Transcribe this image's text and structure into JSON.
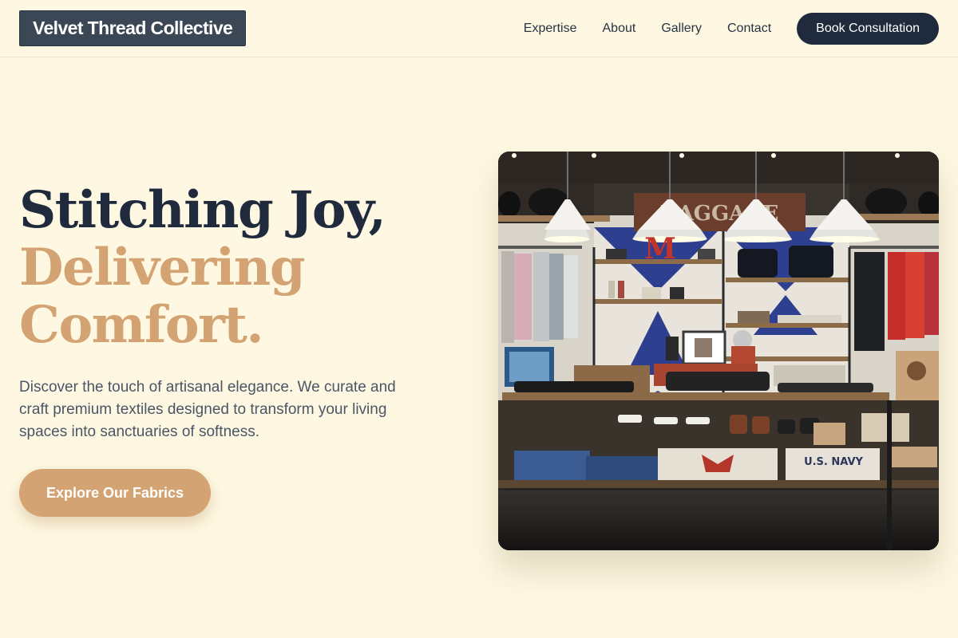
{
  "header": {
    "logo": "Velvet Thread Collective",
    "nav": [
      "Expertise",
      "About",
      "Gallery",
      "Contact"
    ],
    "cta": "Book Consultation"
  },
  "hero": {
    "title_line1": "Stitching Joy,",
    "title_line2": "Delivering",
    "title_line3": "Comfort.",
    "description": "Discover the touch of artisanal elegance. We curate and craft premium textiles designed to transform your living spaces into sanctuaries of softness.",
    "cta": "Explore Our Fabrics",
    "image": {
      "subject": "clothing-store-interior",
      "sign_text": "BAGGAGE",
      "shelf_letter": "M",
      "folded_shirt_text": "U.S. NAVY"
    }
  },
  "colors": {
    "background": "#fef8e2",
    "primary_dark": "#1f2a3c",
    "accent": "#d4a373",
    "logo_bg": "#3c4756",
    "body_text": "#4a5566"
  }
}
